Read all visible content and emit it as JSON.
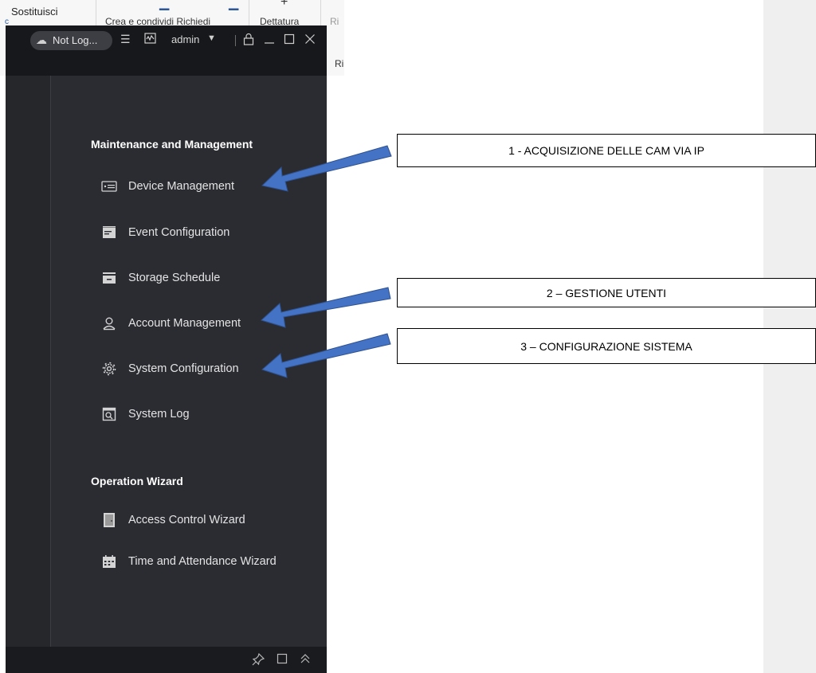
{
  "ribbon": {
    "find_replace_label": "Sostituisci",
    "share_label": "Crea e condividi Richiedi",
    "dictate_label": "Dettatura",
    "trunc_label": "Ri",
    "trunc_label2": "Ri"
  },
  "titlebar": {
    "login_status": "Not Log...",
    "user": "admin"
  },
  "sections": [
    {
      "title": "Maintenance and Management",
      "items": [
        {
          "label": "Device Management",
          "icon": "device-icon"
        },
        {
          "label": "Event Configuration",
          "icon": "event-icon"
        },
        {
          "label": "Storage Schedule",
          "icon": "storage-icon"
        },
        {
          "label": "Account Management",
          "icon": "user-icon"
        },
        {
          "label": "System Configuration",
          "icon": "gear-icon"
        },
        {
          "label": "System Log",
          "icon": "log-icon"
        }
      ]
    },
    {
      "title": "Operation Wizard",
      "items": [
        {
          "label": "Access Control Wizard",
          "icon": "door-icon"
        },
        {
          "label": "Time and Attendance Wizard",
          "icon": "calendar-icon"
        }
      ]
    }
  ],
  "callouts": [
    "1 - ACQUISIZIONE DELLE CAM VIA IP",
    "2 – GESTIONE UTENTI",
    "3 – CONFIGURAZIONE SISTEMA"
  ],
  "colors": {
    "app_bg": "#2b2c31",
    "titlebar_bg": "#17181b",
    "arrow_fill": "#4472c4",
    "arrow_stroke": "#2f528f"
  }
}
